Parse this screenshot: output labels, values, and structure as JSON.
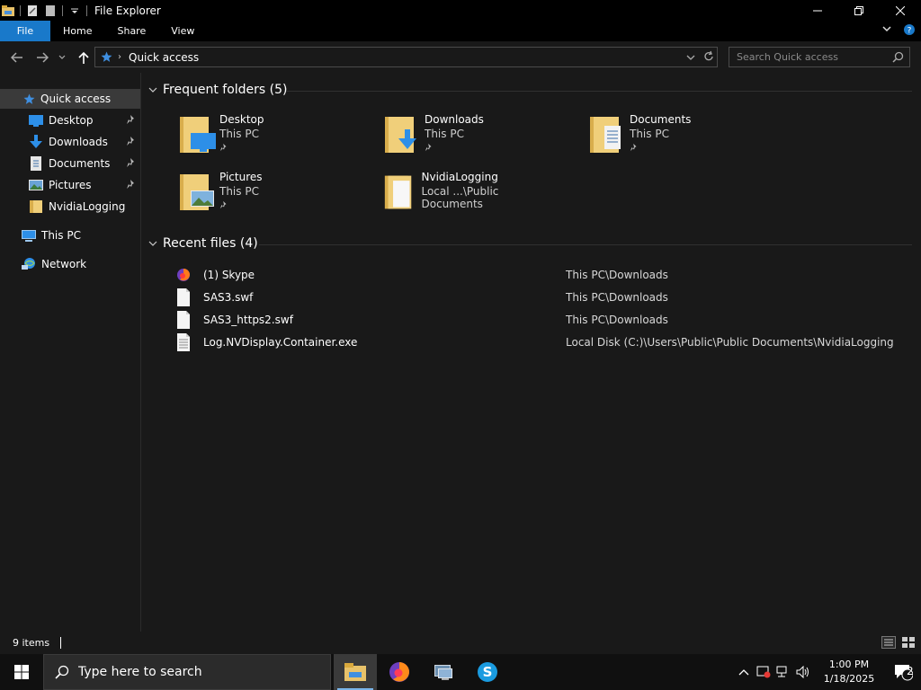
{
  "window": {
    "title": "File Explorer"
  },
  "ribbon": {
    "tabs": [
      {
        "label": "File"
      },
      {
        "label": "Home"
      },
      {
        "label": "Share"
      },
      {
        "label": "View"
      }
    ]
  },
  "address": {
    "crumb": "Quick access",
    "search_placeholder": "Search Quick access"
  },
  "nav": {
    "quick_access": "Quick access",
    "items": [
      {
        "label": "Desktop",
        "icon": "desktop-icon",
        "pinned": true
      },
      {
        "label": "Downloads",
        "icon": "downloads-icon",
        "pinned": true
      },
      {
        "label": "Documents",
        "icon": "documents-icon",
        "pinned": true
      },
      {
        "label": "Pictures",
        "icon": "pictures-icon",
        "pinned": true
      },
      {
        "label": "NvidiaLogging",
        "icon": "folder-icon",
        "pinned": false
      }
    ],
    "this_pc": "This PC",
    "network": "Network"
  },
  "frequent": {
    "header": "Frequent folders (5)",
    "folders": [
      {
        "name": "Desktop",
        "location": "This PC",
        "pinned": true
      },
      {
        "name": "Downloads",
        "location": "This PC",
        "pinned": true
      },
      {
        "name": "Documents",
        "location": "This PC",
        "pinned": true
      },
      {
        "name": "Pictures",
        "location": "This PC",
        "pinned": true
      },
      {
        "name": "NvidiaLogging",
        "location": "Local ...\\Public Documents",
        "pinned": false
      }
    ]
  },
  "recent": {
    "header": "Recent files (4)",
    "files": [
      {
        "name": "(1) Skype",
        "path": "This PC\\Downloads",
        "icon": "firefox-file-icon"
      },
      {
        "name": "SAS3.swf",
        "path": "This PC\\Downloads",
        "icon": "file-icon"
      },
      {
        "name": "SAS3_https2.swf",
        "path": "This PC\\Downloads",
        "icon": "file-icon"
      },
      {
        "name": "Log.NVDisplay.Container.exe",
        "path": "Local Disk (C:)\\Users\\Public\\Public Documents\\NvidiaLogging",
        "icon": "text-file-icon"
      }
    ]
  },
  "status": {
    "count": "9 items"
  },
  "taskbar": {
    "search_placeholder": "Type here to search",
    "time": "1:00 PM",
    "date": "1/18/2025",
    "notification_count": "2"
  },
  "colors": {
    "accent": "#1979ca",
    "folder_yellow": "#e8c26a"
  }
}
